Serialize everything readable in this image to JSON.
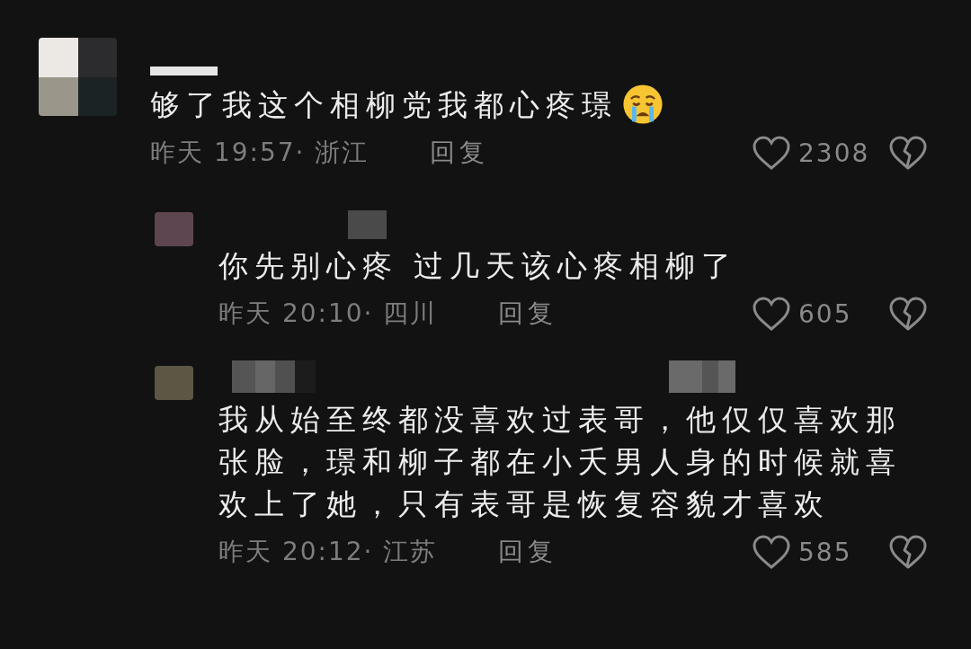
{
  "comments": [
    {
      "text": "够了我这个相柳党我都心疼璟",
      "has_emoji": true,
      "meta": "昨天 19:57· 浙江",
      "reply": "回复",
      "likes": "2308",
      "children": [
        {
          "text": "你先别心疼  过几天该心疼相柳了",
          "meta": "昨天 20:10· 四川",
          "reply": "回复",
          "likes": "605"
        },
        {
          "text": "我从始至终都没喜欢过表哥，他仅仅喜欢那张脸，璟和柳子都在小夭男人身的时候就喜欢上了她，只有表哥是恢复容貌才喜欢",
          "meta": "昨天 20:12· 江苏",
          "reply": "回复",
          "likes": "585"
        }
      ]
    }
  ]
}
